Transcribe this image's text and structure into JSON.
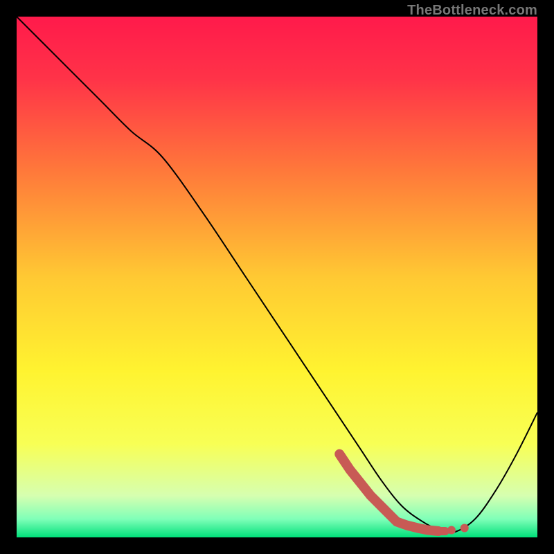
{
  "watermark": "TheBottleneck.com",
  "chart_data": {
    "type": "line",
    "title": "",
    "xlabel": "",
    "ylabel": "",
    "xlim": [
      0,
      100
    ],
    "ylim": [
      0,
      100
    ],
    "grid": false,
    "legend": false,
    "background_gradient": {
      "stops": [
        {
          "offset": 0.0,
          "color": "#ff1a4b"
        },
        {
          "offset": 0.12,
          "color": "#ff3348"
        },
        {
          "offset": 0.3,
          "color": "#ff7a3a"
        },
        {
          "offset": 0.5,
          "color": "#ffc933"
        },
        {
          "offset": 0.68,
          "color": "#fff330"
        },
        {
          "offset": 0.82,
          "color": "#f8ff55"
        },
        {
          "offset": 0.92,
          "color": "#d6ffb0"
        },
        {
          "offset": 0.965,
          "color": "#7fffb8"
        },
        {
          "offset": 1.0,
          "color": "#00e07a"
        }
      ]
    },
    "series": [
      {
        "name": "curve",
        "stroke": "#000000",
        "x": [
          0,
          8,
          16,
          22,
          28,
          36,
          44,
          52,
          60,
          66,
          70,
          74,
          78,
          81,
          84,
          88,
          92,
          96,
          100
        ],
        "y": [
          100,
          92,
          84,
          78,
          73,
          62,
          50,
          38,
          26,
          17,
          11,
          6,
          3,
          1.5,
          1,
          3.5,
          9,
          16,
          24
        ]
      }
    ],
    "highlight_segment": {
      "name": "minimum-band",
      "color": "#c85a55",
      "x": [
        62,
        64,
        66,
        68,
        70,
        72,
        73,
        75,
        77,
        79,
        81
      ],
      "y": [
        16,
        13,
        10.5,
        8,
        6,
        4,
        3,
        2.3,
        1.8,
        1.4,
        1.2
      ],
      "end_dots_x": [
        83.5,
        86
      ],
      "end_dots_y": [
        1.4,
        1.8
      ]
    }
  }
}
